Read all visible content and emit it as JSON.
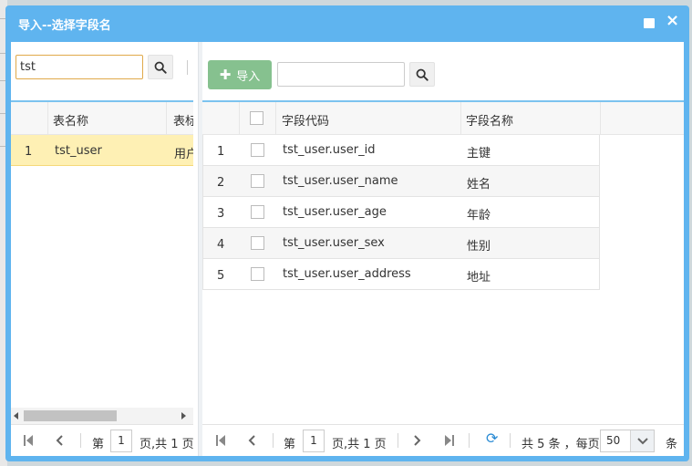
{
  "dialog": {
    "title": "导入--选择字段名",
    "maximize_icon": "square-icon",
    "close_icon": "×"
  },
  "left_panel": {
    "search_value": "tst",
    "columns": [
      "表名称",
      "表标"
    ],
    "rows": [
      {
        "num": "1",
        "name": "tst_user",
        "label": "用户"
      }
    ],
    "pager": {
      "page_prefix": "第",
      "page_value": "1",
      "page_suffix": "页,共 1 页"
    }
  },
  "right_panel": {
    "import_label": "导入",
    "search_value": "",
    "columns": [
      "字段代码",
      "字段名称"
    ],
    "rows": [
      {
        "num": "1",
        "code": "tst_user.user_id",
        "name": "主键"
      },
      {
        "num": "2",
        "code": "tst_user.user_name",
        "name": "姓名"
      },
      {
        "num": "3",
        "code": "tst_user.user_age",
        "name": "年龄"
      },
      {
        "num": "4",
        "code": "tst_user.user_sex",
        "name": "性别"
      },
      {
        "num": "5",
        "code": "tst_user.user_address",
        "name": "地址"
      }
    ],
    "pager": {
      "page_prefix": "第",
      "page_value": "1",
      "page_suffix": "页,共 1 页",
      "total": "共 5 条 ，每页",
      "per_page": "50",
      "per_page_unit": "条"
    }
  },
  "colors": {
    "title_bar": "#5fb4ef",
    "import_button": "#86c18f",
    "selected_row": "#fef0b4",
    "search_focus_border": "#e0a94a"
  }
}
